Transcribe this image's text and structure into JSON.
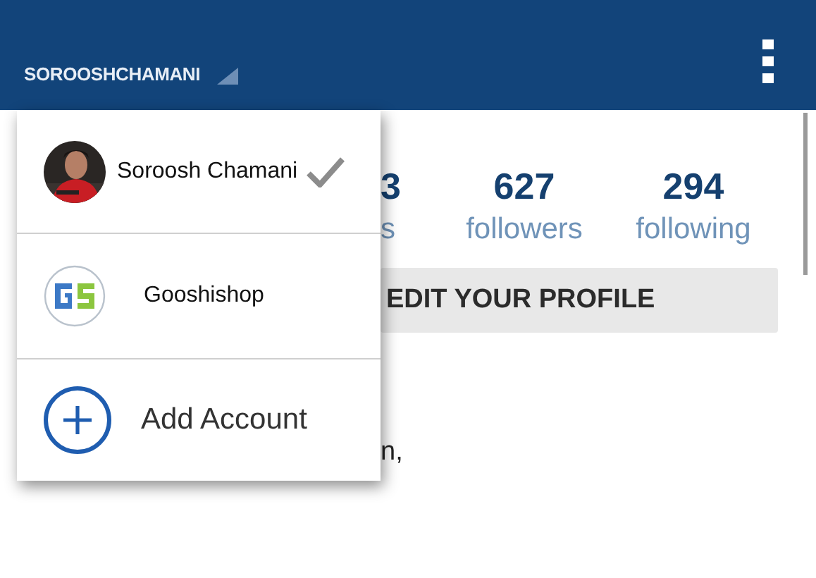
{
  "header": {
    "username": "SOROOSHCHAMANI"
  },
  "stats": [
    {
      "count": "3",
      "label": "s"
    },
    {
      "count": "627",
      "label": "followers"
    },
    {
      "count": "294",
      "label": "following"
    }
  ],
  "edit_button": "EDIT YOUR PROFILE",
  "bio": "n,",
  "account_menu": {
    "accounts": [
      {
        "name": "Soroosh Chamani",
        "selected": true
      },
      {
        "name": "Gooshishop",
        "kind": "logo",
        "selected": false
      }
    ],
    "add_label": "Add Account"
  }
}
